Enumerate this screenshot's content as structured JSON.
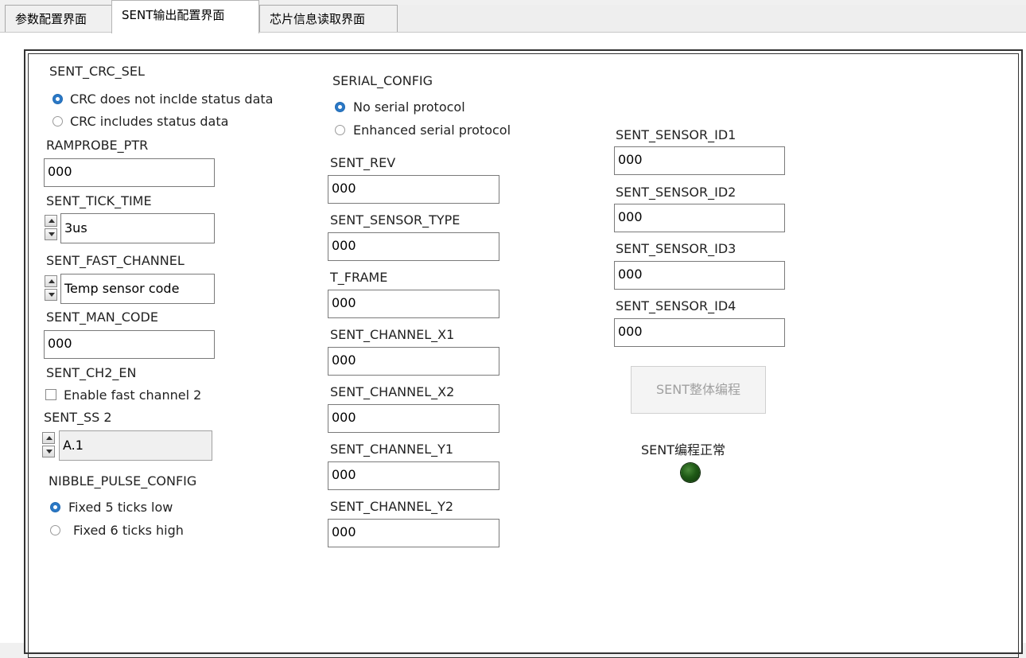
{
  "tabs": [
    {
      "label": "参数配置界面",
      "active": false
    },
    {
      "label": "SENT输出配置界面",
      "active": true
    },
    {
      "label": "芯片信息读取界面",
      "active": false
    }
  ],
  "col1": {
    "crc_sel": {
      "label": "SENT_CRC_SEL",
      "options": [
        "CRC does not inclde status data",
        "CRC includes status data"
      ],
      "selected": 0
    },
    "ramprobe_ptr": {
      "label": "RAMPROBE_PTR",
      "value": "000"
    },
    "tick_time": {
      "label": "SENT_TICK_TIME",
      "value": "3us"
    },
    "fast_channel": {
      "label": "SENT_FAST_CHANNEL",
      "value": "Temp sensor code"
    },
    "man_code": {
      "label": "SENT_MAN_CODE",
      "value": "000"
    },
    "ch2_en": {
      "label": "SENT_CH2_EN",
      "checkbox_label": "Enable fast channel 2",
      "checked": false
    },
    "ss2": {
      "label": "SENT_SS 2",
      "value": "A.1"
    },
    "nibble": {
      "label": "NIBBLE_PULSE_CONFIG",
      "options": [
        "Fixed 5 ticks low",
        "Fixed 6 ticks high"
      ],
      "selected": 0
    }
  },
  "col2": {
    "serial_config": {
      "label": "SERIAL_CONFIG",
      "options": [
        "No serial protocol",
        "Enhanced serial protocol"
      ],
      "selected": 0
    },
    "fields": [
      {
        "label": "SENT_REV",
        "value": "000"
      },
      {
        "label": "SENT_SENSOR_TYPE",
        "value": "000"
      },
      {
        "label": "T_FRAME",
        "value": "000"
      },
      {
        "label": "SENT_CHANNEL_X1",
        "value": "000"
      },
      {
        "label": "SENT_CHANNEL_X2",
        "value": "000"
      },
      {
        "label": "SENT_CHANNEL_Y1",
        "value": "000"
      },
      {
        "label": "SENT_CHANNEL_Y2",
        "value": "000"
      }
    ]
  },
  "col3": {
    "fields": [
      {
        "label": "SENT_SENSOR_ID1",
        "value": "000"
      },
      {
        "label": "SENT_SENSOR_ID2",
        "value": "000"
      },
      {
        "label": "SENT_SENSOR_ID3",
        "value": "000"
      },
      {
        "label": "SENT_SENSOR_ID4",
        "value": "000"
      }
    ],
    "program_button": "SENT整体编程",
    "status_label": "SENT编程正常",
    "status_led_color": "#1f5a16"
  }
}
